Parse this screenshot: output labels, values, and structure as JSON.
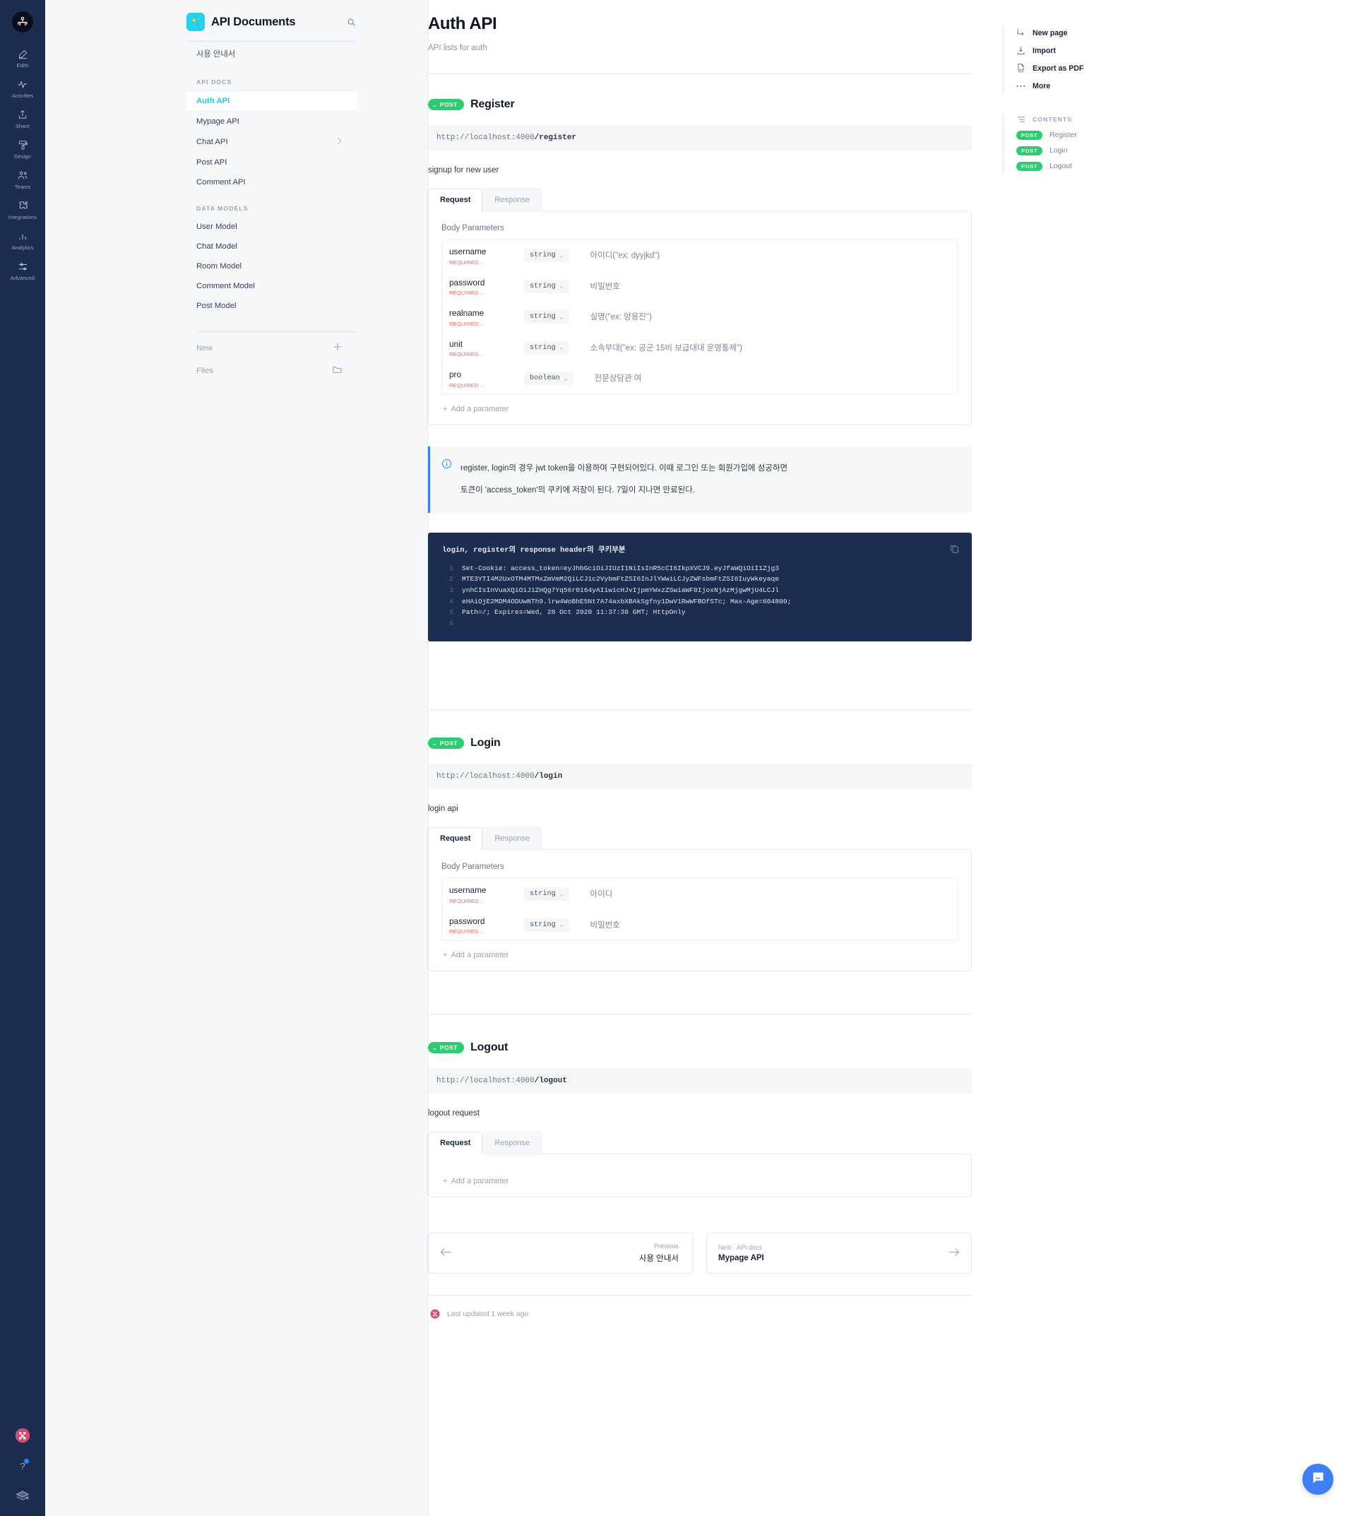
{
  "rail": {
    "logo_icon": "people-clock-logo-icon",
    "items": [
      {
        "label": "Edits",
        "icon": "pencil-icon"
      },
      {
        "label": "Activities",
        "icon": "activity-pulse-icon"
      },
      {
        "label": "Share",
        "icon": "share-upload-icon"
      },
      {
        "label": "Design",
        "icon": "paint-roller-icon"
      },
      {
        "label": "Teams",
        "icon": "people-icon"
      },
      {
        "label": "Integrations",
        "icon": "puzzle-piece-icon"
      },
      {
        "label": "Analytics",
        "icon": "bar-chart-icon"
      },
      {
        "label": "Advanced",
        "icon": "sliders-icon"
      }
    ],
    "bottom": {
      "avatar_icon": "user-avatar-icon",
      "help_icon": "question-mark-icon",
      "help_badge": true,
      "books_icon": "books-stack-icon"
    }
  },
  "sidebar": {
    "logo_icon": "sparkles-icon",
    "title": "API Documents",
    "search_icon": "search-icon",
    "top_link": {
      "label": "사용 안내서"
    },
    "sections": [
      {
        "title": "API DOCS",
        "items": [
          {
            "label": "Auth API",
            "active": true,
            "chevron": false
          },
          {
            "label": "Mypage API",
            "active": false,
            "chevron": false
          },
          {
            "label": "Chat API",
            "active": false,
            "chevron": true
          },
          {
            "label": "Post API",
            "active": false,
            "chevron": false
          },
          {
            "label": "Comment API",
            "active": false,
            "chevron": false
          }
        ]
      },
      {
        "title": "DATA MODELS",
        "items": [
          {
            "label": "User Model",
            "active": false,
            "chevron": false
          },
          {
            "label": "Chat Model",
            "active": false,
            "chevron": false
          },
          {
            "label": "Room Model",
            "active": false,
            "chevron": false
          },
          {
            "label": "Comment Model",
            "active": false,
            "chevron": false
          },
          {
            "label": "Post Model",
            "active": false,
            "chevron": false
          }
        ]
      }
    ],
    "footer": [
      {
        "label": "New",
        "action_icon": "plus-icon"
      },
      {
        "label": "Files",
        "action_icon": "folder-icon"
      }
    ]
  },
  "page": {
    "title": "Auth API",
    "subtitle": "API lists for auth"
  },
  "endpoints": [
    {
      "method": "POST",
      "name": "Register",
      "url_base": "http://localhost:4000",
      "url_path": "/register",
      "description": "signup for new user",
      "tabs": [
        {
          "label": "Request",
          "active": true
        },
        {
          "label": "Response",
          "active": false
        }
      ],
      "body_label": "Body Parameters",
      "required_label": "REQUIRED",
      "add_parameter_label": "Add a parameter",
      "parameters": [
        {
          "name": "username",
          "required": "REQUIRED",
          "type": "string",
          "description": "아이디(\"ex: dyyjkd\")"
        },
        {
          "name": "password",
          "required": "REQUIRED",
          "type": "string",
          "description": "비밀번호"
        },
        {
          "name": "realname",
          "required": "REQUIRED",
          "type": "string",
          "description": "실명(\"ex: 양용진\")"
        },
        {
          "name": "unit",
          "required": "REQUIRED",
          "type": "string",
          "description": "소속부대(\"ex: 공군 15비 보급대대 운영통제\")"
        },
        {
          "name": "pro",
          "required": "REQUIRED",
          "type": "boolean",
          "description": "전문상담관 여"
        }
      ]
    },
    {
      "method": "POST",
      "name": "Login",
      "url_base": "http://localhost:4000",
      "url_path": "/login",
      "description": "login api",
      "tabs": [
        {
          "label": "Request",
          "active": true
        },
        {
          "label": "Response",
          "active": false
        }
      ],
      "body_label": "Body Parameters",
      "add_parameter_label": "Add a parameter",
      "parameters": [
        {
          "name": "username",
          "required": "REQUIRED",
          "type": "string",
          "description": "아이디"
        },
        {
          "name": "password",
          "required": "REQUIRED",
          "type": "string",
          "description": "비밀번호"
        }
      ]
    },
    {
      "method": "POST",
      "name": "Logout",
      "url_base": "http://localhost:4000",
      "url_path": "/logout",
      "description": "logout request",
      "tabs": [
        {
          "label": "Request",
          "active": true
        },
        {
          "label": "Response",
          "active": false
        }
      ],
      "body_label": "",
      "add_parameter_label": "Add a parameter",
      "parameters": []
    }
  ],
  "callout": {
    "icon": "info-circle-icon",
    "line1": "register, login의 경우 jwt token을 이용하여 구현되어있다. 이때 로그인 또는 회원가입에 성공하면",
    "line2": "토큰이 'access_token'의 쿠키에 저장이 된다. 7일이 지나면 만료된다."
  },
  "code_block": {
    "title": "login, register의 response header의 쿠키부분",
    "copy_icon": "copy-icon",
    "lines": [
      {
        "n": "1",
        "text": "Set-Cookie: access_token=eyJhbGciOiJIUzI1NiIsInR5cCI6IkpXVCJ9.eyJfaWQiOiI1Zjg3"
      },
      {
        "n": "2",
        "text": "MTE3YTI4M2UxOTM4MTMxZmVmM2QiLCJ1c2VybmFtZSI6InJlYWwiLCJyZWFsbmFtZSI6IuyWkeyaqe"
      },
      {
        "n": "3",
        "text": "ynhCIsInVuaXQiOiJ1ZHQg7Yq56r0164yAIiwicHJvIjpmYWxzZSwiaWF0IjoxNjAzMjgwMjU4LCJl"
      },
      {
        "n": "4",
        "text": "eHAiOjE2MDM4ODUwNTh9.lrw4WoBhE5Nt7A74axbXBAkSgfny1DwV1RwWFBOfSTc; Max-Age=604800;"
      },
      {
        "n": "5",
        "text": "Path=/; Expires=Wed, 28 Oct 2020 11:37:38 GMT; HttpOnly"
      },
      {
        "n": "6",
        "text": ""
      }
    ]
  },
  "footer_nav": {
    "previous": {
      "kicker": "Previous",
      "label": "사용 안내서",
      "arrow_icon": "arrow-left-icon"
    },
    "next": {
      "kicker": "Next · API docs",
      "label": "Mypage API",
      "arrow_icon": "arrow-right-icon"
    }
  },
  "last_updated": {
    "avatar_icon": "user-avatar-icon",
    "text": "Last updated 1 week ago"
  },
  "right_panel": {
    "actions": [
      {
        "label": "New page",
        "icon": "new-page-icon"
      },
      {
        "label": "Import",
        "icon": "import-download-icon"
      },
      {
        "label": "Export as PDF",
        "icon": "export-pdf-icon"
      },
      {
        "label": "More",
        "icon": "ellipsis-icon"
      }
    ],
    "contents_title": "CONTENTS",
    "contents_icon": "list-lines-icon",
    "contents": [
      {
        "method": "POST",
        "label": "Register"
      },
      {
        "method": "POST",
        "label": "Login"
      },
      {
        "method": "POST",
        "label": "Logout"
      }
    ]
  },
  "intercom": {
    "icon": "chat-bubble-icon"
  },
  "colors": {
    "rail_bg": "#1d2d50",
    "accent_cyan": "#1ec8e0",
    "method_green": "#2ecc71",
    "required_red": "#f0635a",
    "callout_blue": "#2f80ff",
    "code_bg": "#1d2d50",
    "intercom_blue": "#3d7ff5"
  }
}
